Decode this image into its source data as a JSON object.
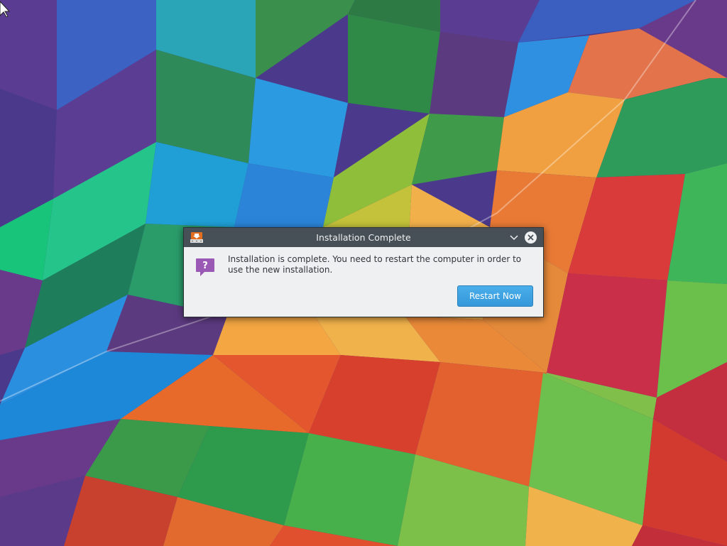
{
  "dialog": {
    "title": "Installation Complete",
    "message": "Installation is complete. You need to restart the computer in order to use the new installation.",
    "restart_label": "Restart Now",
    "titlebar_icons": {
      "app": "installer-icon",
      "minimize": "chevron-down-icon",
      "close": "close-icon"
    },
    "message_icon": "question-icon"
  },
  "colors": {
    "titlebar": "#475057",
    "dialog_bg": "#eff0f1",
    "button_accent": "#3498db",
    "question_icon": "#9b59b6",
    "text": "#31363b"
  }
}
